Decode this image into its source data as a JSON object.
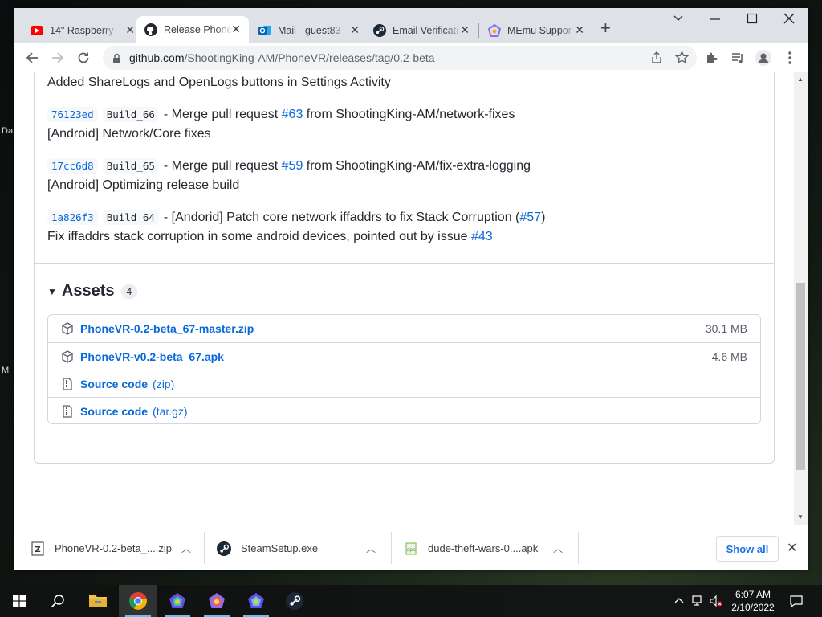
{
  "desktop": {
    "fragments": [
      "Da",
      "M"
    ]
  },
  "tabs": [
    {
      "label": "14\" Raspberry",
      "icon": "youtube-icon"
    },
    {
      "label": "Release Phone",
      "icon": "github-icon",
      "active": true
    },
    {
      "label": "Mail - guest83",
      "icon": "outlook-icon"
    },
    {
      "label": "Email Verificati",
      "icon": "steam-icon"
    },
    {
      "label": "MEmu Suppor",
      "icon": "memu-icon"
    }
  ],
  "address": {
    "host": "github.com",
    "path": "/ShootingKing-AM/PhoneVR/releases/tag/0.2-beta"
  },
  "notes": {
    "top_line": "Added ShareLogs and OpenLogs buttons in Settings Activity",
    "commits": [
      {
        "sha": "76123ed",
        "build": "Build_66",
        "pre": "- Merge pull request ",
        "pr": "#63",
        "post": " from ShootingKing-AM/network-fixes",
        "desc": "[Android] Network/Core fixes"
      },
      {
        "sha": "17cc6d8",
        "build": "Build_65",
        "pre": "- Merge pull request ",
        "pr": "#59",
        "post": " from ShootingKing-AM/fix-extra-logging",
        "desc": "[Android] Optimizing release build"
      },
      {
        "sha": "1a826f3",
        "build": "Build_64",
        "pre": "- [Andorid] Patch core network iffaddrs to fix Stack Corruption (",
        "pr": "#57",
        "post": ")",
        "desc": "Fix iffaddrs stack corruption in some android devices, pointed out by issue ",
        "desc_link": "#43"
      }
    ]
  },
  "assets": {
    "title": "Assets",
    "count": "4",
    "items": [
      {
        "name": "PhoneVR-0.2-beta_67-master.zip",
        "size": "30.1 MB",
        "icon": "package-icon"
      },
      {
        "name": "PhoneVR-v0.2-beta_67.apk",
        "size": "4.6 MB",
        "icon": "package-icon"
      },
      {
        "name": "Source code",
        "sub": "(zip)",
        "icon": "file-zip-icon"
      },
      {
        "name": "Source code",
        "sub": "(tar.gz)",
        "icon": "file-zip-icon"
      }
    ]
  },
  "downloads": {
    "items": [
      {
        "name": "PhoneVR-0.2-beta_....zip",
        "icon": "zip-file-icon"
      },
      {
        "name": "SteamSetup.exe",
        "icon": "steam-icon"
      },
      {
        "name": "dude-theft-wars-0....apk",
        "icon": "apk-file-icon"
      }
    ],
    "show_all": "Show all"
  },
  "clock": {
    "time": "6:07 AM",
    "date": "2/10/2022"
  },
  "colors": {
    "link": "#0969da",
    "chrome_tabstrip": "#dee1e6",
    "taskbar": "#101212"
  }
}
